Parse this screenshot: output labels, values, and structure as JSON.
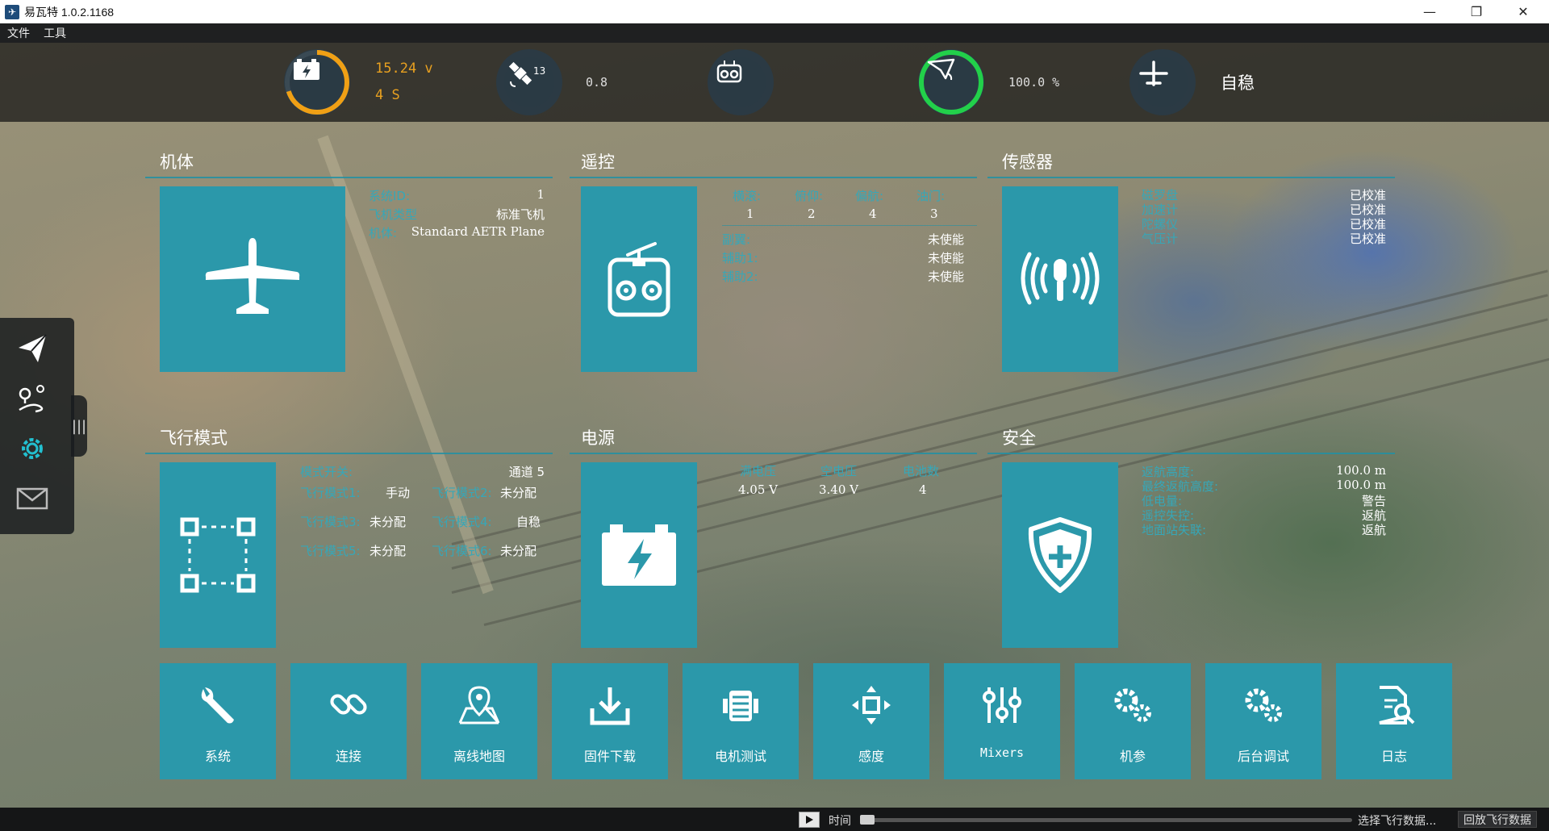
{
  "window": {
    "title": "易瓦特 1.0.2.1168",
    "minimize": "—",
    "restore": "❐",
    "close": "✕"
  },
  "menu": [
    "文件",
    "工具"
  ],
  "status": {
    "battery": {
      "voltage": "15.24 v",
      "cells": "4 S",
      "level": 0.7,
      "color": "#f0a015"
    },
    "gps": {
      "sat_count": "13",
      "hdop": "0.8"
    },
    "rc": {
      "icon": "remote-icon"
    },
    "link": {
      "quality": "100.0 %",
      "level": 1.0,
      "color": "#22d04a"
    },
    "mode": {
      "label": "自稳"
    }
  },
  "sections": {
    "airframe": {
      "title": "机体",
      "rows": [
        {
          "label": "系统ID:",
          "value": "1"
        },
        {
          "label": "飞机类型",
          "value": "标准飞机"
        },
        {
          "label": "机体:",
          "value": "Standard AETR Plane"
        }
      ]
    },
    "rc": {
      "title": "遥控",
      "channels": [
        {
          "label": "横滚:",
          "value": "1"
        },
        {
          "label": "俯仰:",
          "value": "2"
        },
        {
          "label": "偏航:",
          "value": "4"
        },
        {
          "label": "油门:",
          "value": "3"
        }
      ],
      "rows": [
        {
          "label": "副翼:",
          "value": "未使能"
        },
        {
          "label": "辅助1:",
          "value": "未使能"
        },
        {
          "label": "辅助2:",
          "value": "未使能"
        }
      ]
    },
    "sensors": {
      "title": "传感器",
      "rows": [
        {
          "label": "磁罗盘",
          "value": "已校准"
        },
        {
          "label": "加速计",
          "value": "已校准"
        },
        {
          "label": "陀螺仪",
          "value": "已校准"
        },
        {
          "label": "气压计",
          "value": "已校准"
        }
      ]
    },
    "flight_modes": {
      "title": "飞行模式",
      "switch": {
        "label": "模式开关:",
        "value": "通道 5"
      },
      "modes": [
        {
          "label": "飞行模式1:",
          "value": "手动"
        },
        {
          "label": "飞行模式2:",
          "value": "未分配"
        },
        {
          "label": "飞行模式3:",
          "value": "未分配"
        },
        {
          "label": "飞行模式4:",
          "value": "自稳"
        },
        {
          "label": "飞行模式5:",
          "value": "未分配"
        },
        {
          "label": "飞行模式6:",
          "value": "未分配"
        }
      ]
    },
    "power": {
      "title": "电源",
      "cols": [
        {
          "label": "满电压",
          "value": "4.05 V"
        },
        {
          "label": "空电压",
          "value": "3.40 V"
        },
        {
          "label": "电池数",
          "value": "4"
        }
      ]
    },
    "safety": {
      "title": "安全",
      "rows": [
        {
          "label": "返航高度:",
          "value": "100.0 m"
        },
        {
          "label": "最终返航高度:",
          "value": "100.0 m"
        },
        {
          "label": "低电量:",
          "value": "警告"
        },
        {
          "label": "遥控失控:",
          "value": "返航"
        },
        {
          "label": "地面站失联:",
          "value": "返航"
        }
      ]
    }
  },
  "dock": [
    "send-icon",
    "route-map-icon",
    "gear-icon",
    "mail-icon"
  ],
  "tools": [
    {
      "label": "系统",
      "icon": "wrench-icon"
    },
    {
      "label": "连接",
      "icon": "link-icon"
    },
    {
      "label": "离线地图",
      "icon": "offline-map-icon"
    },
    {
      "label": "固件下载",
      "icon": "download-icon"
    },
    {
      "label": "电机测试",
      "icon": "motor-icon"
    },
    {
      "label": "感度",
      "icon": "move-icon"
    },
    {
      "label": "Mixers",
      "icon": "sliders-icon"
    },
    {
      "label": "机参",
      "icon": "gears-icon"
    },
    {
      "label": "后台调试",
      "icon": "gears-icon"
    },
    {
      "label": "日志",
      "icon": "log-search-icon"
    }
  ],
  "footer": {
    "time_label": "时间",
    "select_flight": "选择飞行数据...",
    "replay": "回放飞行数据"
  }
}
